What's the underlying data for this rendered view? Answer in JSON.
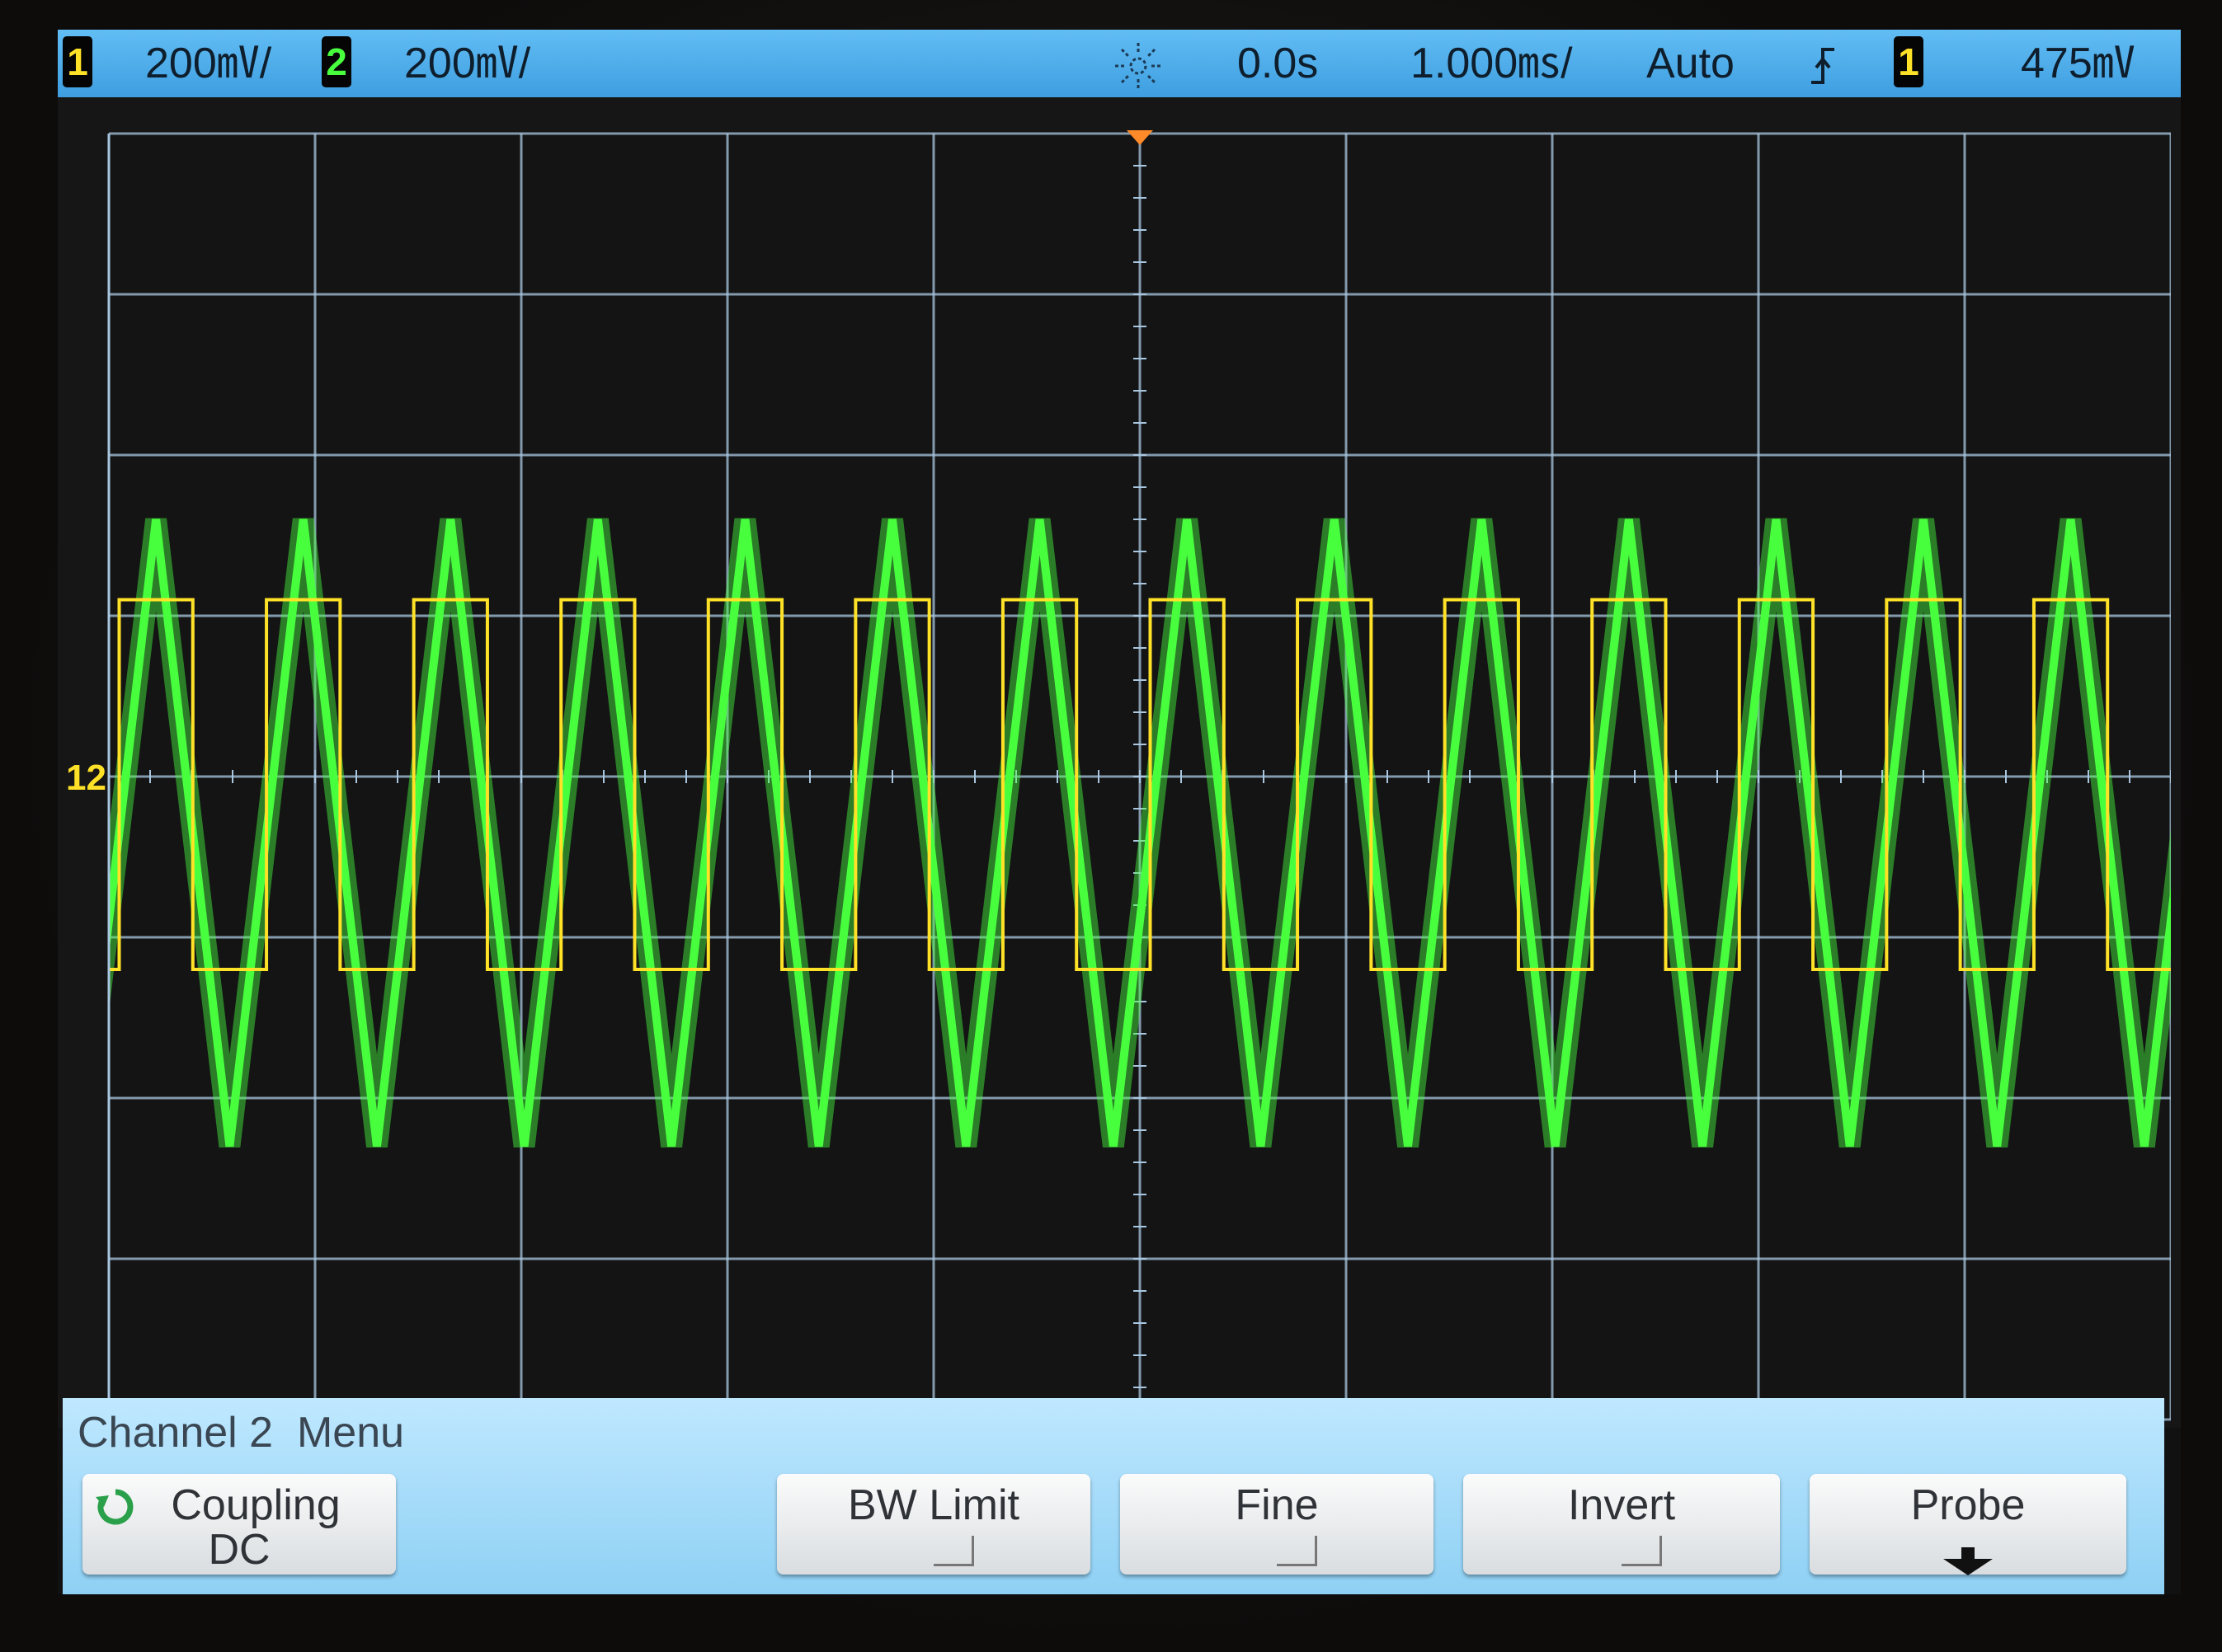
{
  "statusbar": {
    "ch1_badge": "1",
    "ch1_scale": "200㎷/",
    "ch2_badge": "2",
    "ch2_scale": "200㎷/",
    "acq_icon": "acquisition-sun-icon",
    "time_delay": "0.0s",
    "time_scale": "1.000㎳/",
    "trigger_mode": "Auto",
    "trigger_slope_icon": "rising-edge-icon",
    "trigger_source_badge": "1",
    "trigger_level": "475㎷"
  },
  "colors": {
    "ch1": "#ffe227",
    "ch2": "#48ff3e",
    "grid": "#a9c7e0",
    "statusbar": "#4faee8",
    "trigger_marker": "#ff8a2a"
  },
  "waveforms": {
    "ch1": {
      "shape": "square",
      "high_div": 1.1,
      "low_div": -1.2,
      "duty": 0.5
    },
    "ch2": {
      "shape": "triangle",
      "peak_div": 1.6,
      "trough_div": -2.3
    },
    "cycles_on_screen": 14,
    "ground_marker": "1 2"
  },
  "menu": {
    "title": "Channel 2  Menu",
    "coupling_label": "Coupling",
    "coupling_value": "DC",
    "bw_limit": "BW Limit",
    "fine": "Fine",
    "invert": "Invert",
    "probe": "Probe"
  }
}
